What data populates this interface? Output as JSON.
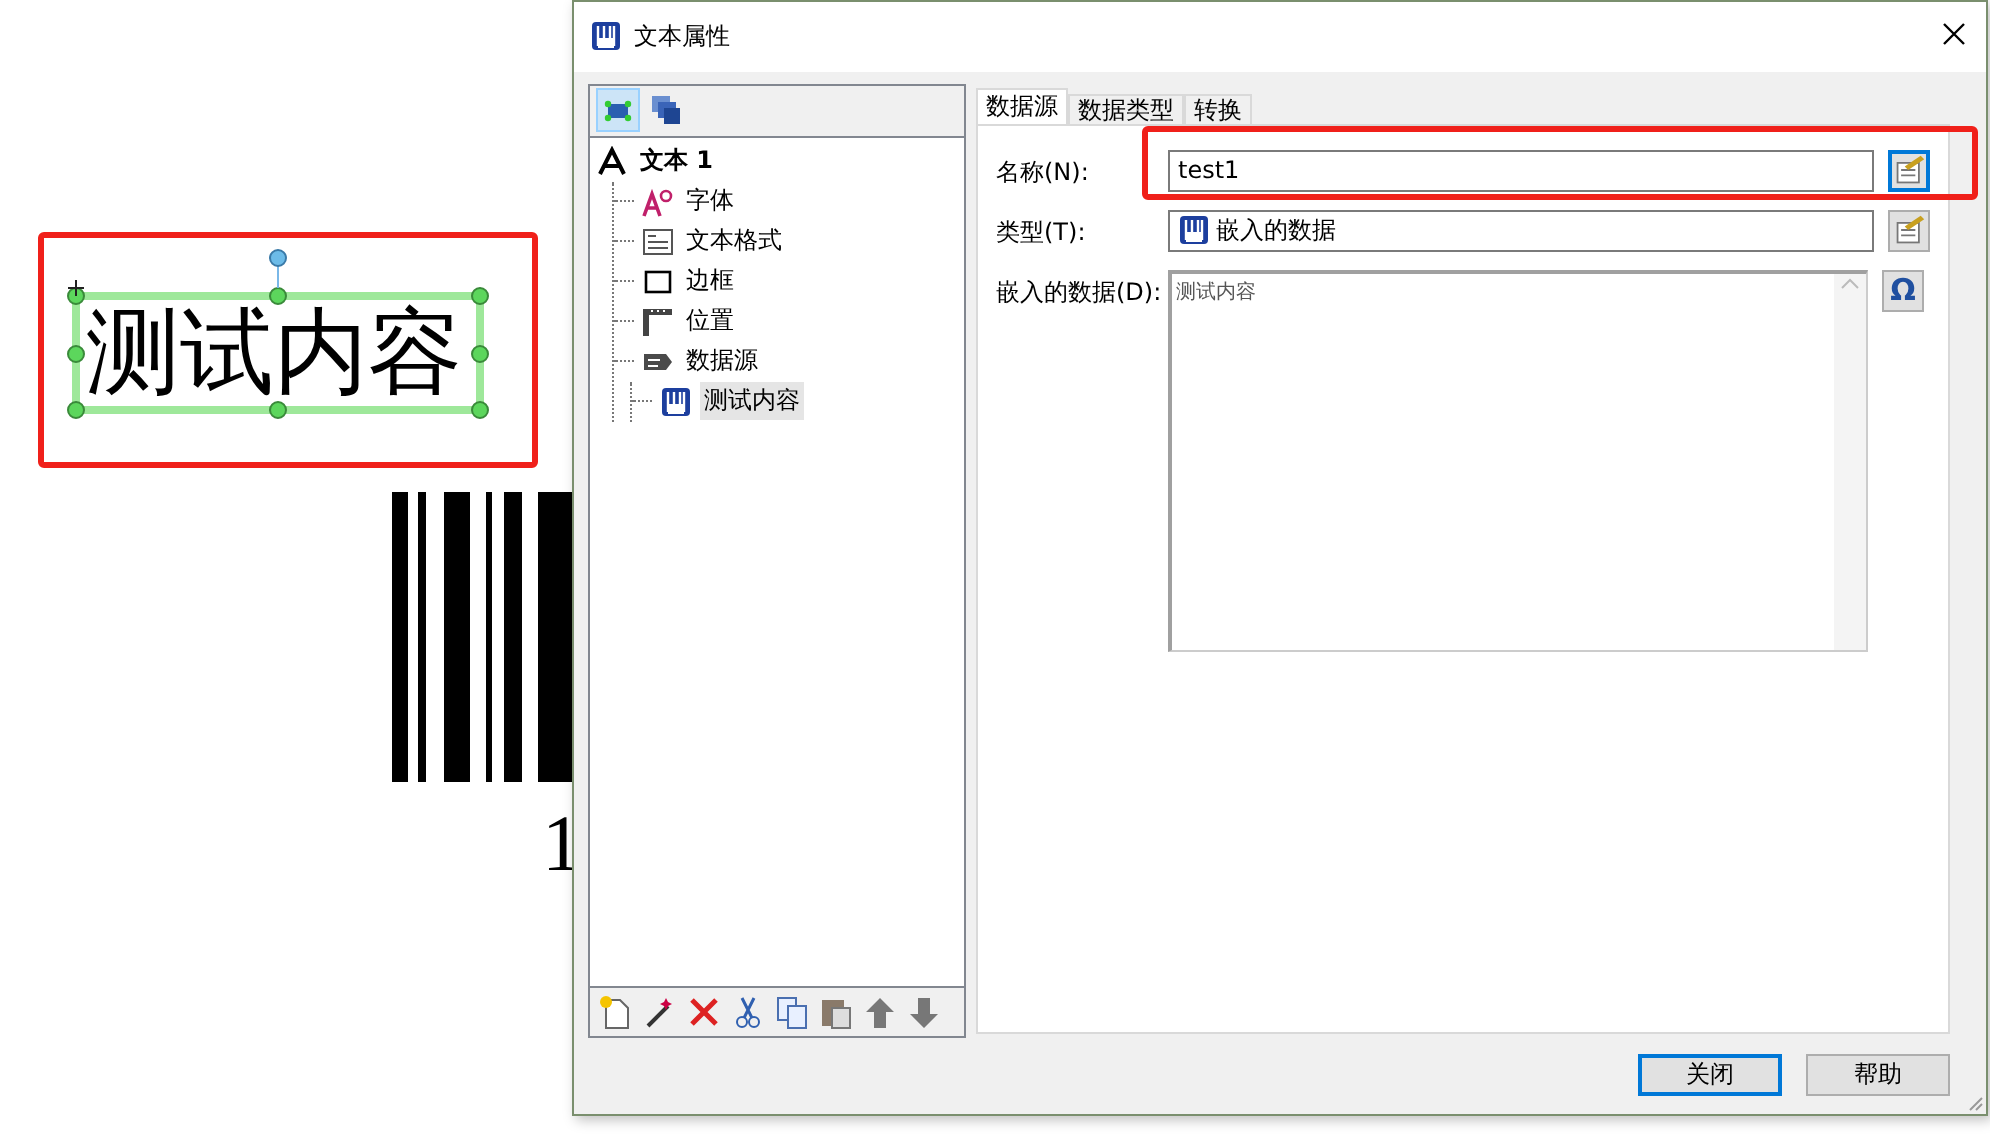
{
  "canvas": {
    "label_text": "测试内容",
    "barcode_digit": "1"
  },
  "dialog": {
    "title": "文本属性",
    "view_toggles": [
      {
        "kind": "object",
        "selected": true
      },
      {
        "kind": "layers",
        "selected": false
      }
    ],
    "tree": [
      {
        "label": "文本 1",
        "kind": "text",
        "selected": false,
        "children": [
          {
            "label": "字体",
            "kind": "font",
            "selected": false
          },
          {
            "label": "文本格式",
            "kind": "format",
            "selected": false
          },
          {
            "label": "边框",
            "kind": "border",
            "selected": false
          },
          {
            "label": "位置",
            "kind": "position",
            "selected": false
          },
          {
            "label": "数据源",
            "kind": "source",
            "selected": false,
            "children": [
              {
                "label": "测试内容",
                "kind": "embedded",
                "selected": true
              }
            ]
          }
        ]
      }
    ],
    "tree_tools": [
      {
        "kind": "new"
      },
      {
        "kind": "wizard"
      },
      {
        "kind": "delete"
      },
      {
        "kind": "cut"
      },
      {
        "kind": "copy"
      },
      {
        "kind": "paste"
      },
      {
        "kind": "up"
      },
      {
        "kind": "down"
      }
    ],
    "tabs": [
      {
        "label": "数据源",
        "selected": true
      },
      {
        "label": "数据类型",
        "selected": false
      },
      {
        "label": "转换",
        "selected": false
      }
    ],
    "fields": [
      {
        "kind": "text",
        "label": "名称(N):",
        "value": "test1"
      },
      {
        "kind": "type",
        "label": "类型(T):",
        "value": "嵌入的数据"
      },
      {
        "kind": "area",
        "label": "嵌入的数据(D):",
        "value": "测试内容",
        "side_symbol": "Ω"
      }
    ],
    "buttons": [
      {
        "label": "关闭",
        "default": true
      },
      {
        "label": "帮助",
        "default": false
      }
    ]
  }
}
